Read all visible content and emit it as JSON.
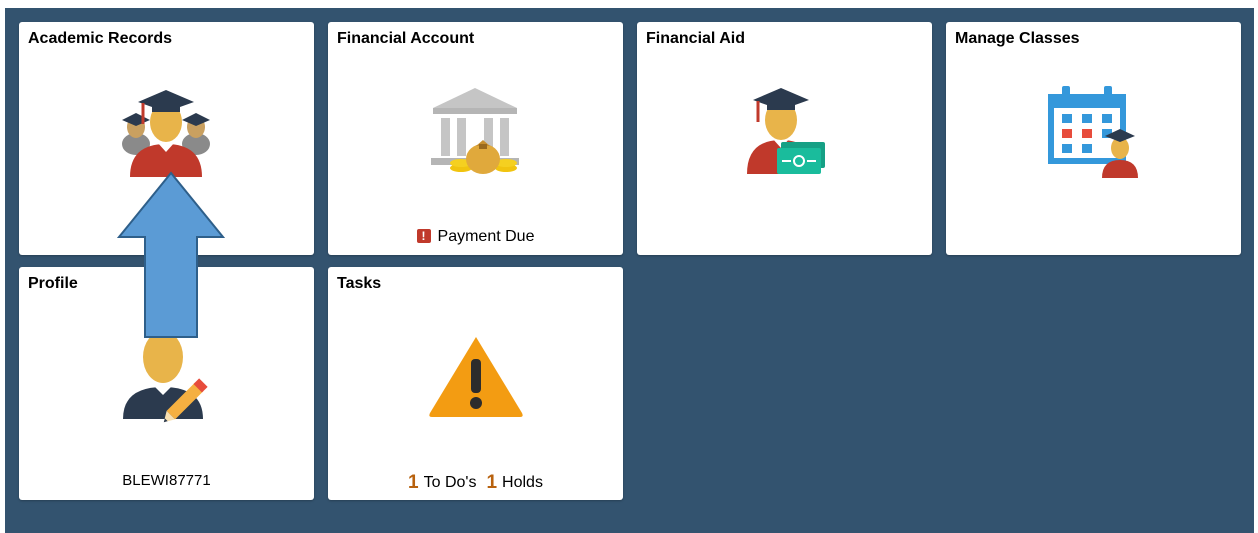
{
  "tiles": {
    "academic_records": {
      "title": "Academic Records"
    },
    "financial_account": {
      "title": "Financial Account",
      "status_icon": "exclamation-icon",
      "status_text": "Payment Due"
    },
    "financial_aid": {
      "title": "Financial Aid"
    },
    "manage_classes": {
      "title": "Manage Classes"
    },
    "profile": {
      "title": "Profile",
      "user_id": "BLEWI87771"
    },
    "tasks": {
      "title": "Tasks",
      "todo_count": "1",
      "todo_label": "To Do's",
      "holds_count": "1",
      "holds_label": "Holds"
    }
  },
  "icons": {
    "academic_records": "graduates-group-icon",
    "financial_account": "bank-money-icon",
    "financial_aid": "graduate-with-cash-icon",
    "manage_classes": "calendar-student-icon",
    "profile": "user-edit-pencil-icon",
    "tasks": "warning-triangle-icon"
  },
  "annotation": {
    "icon": "up-arrow-icon"
  },
  "colors": {
    "background": "#33536f",
    "tile": "#ffffff",
    "skin": "#e8b44a",
    "robe_red": "#c0392b",
    "cap": "#2b3a4e",
    "warning": "#f39c12",
    "alert": "#c0392b",
    "count": "#b8620f",
    "arrow": "#5b9bd5",
    "calendar_blue": "#3498db",
    "money_green": "#1abc9c"
  }
}
